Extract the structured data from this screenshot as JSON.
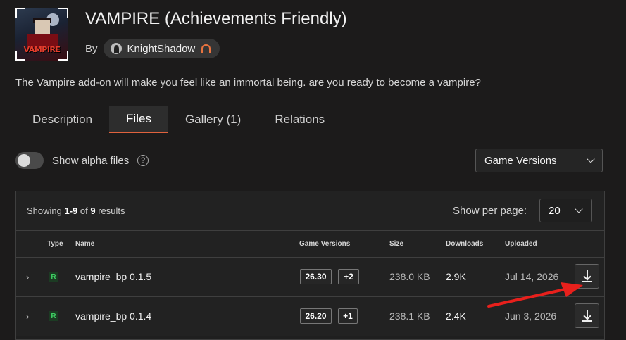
{
  "project": {
    "title": "VAMPIRE (Achievements Friendly)",
    "by_label": "By",
    "author": "KnightShadow",
    "thumbnail_text": "VAMPIRE",
    "description": "The Vampire add-on will make you feel like an immortal being. are you ready to become a vampire?"
  },
  "tabs": [
    {
      "label": "Description",
      "active": false
    },
    {
      "label": "Files",
      "active": true
    },
    {
      "label": "Gallery (1)",
      "active": false
    },
    {
      "label": "Relations",
      "active": false
    }
  ],
  "filters": {
    "alpha_toggle_label": "Show alpha files",
    "alpha_toggle_on": false,
    "help_glyph": "?",
    "game_versions_label": "Game Versions"
  },
  "results": {
    "showing_prefix": "Showing ",
    "range": "1-9",
    "of": " of ",
    "total": "9",
    "suffix": " results",
    "per_page_label": "Show per page:",
    "per_page_value": "20"
  },
  "table": {
    "headers": {
      "type": "Type",
      "name": "Name",
      "game_versions": "Game Versions",
      "size": "Size",
      "downloads": "Downloads",
      "uploaded": "Uploaded"
    },
    "rows": [
      {
        "expand": "›",
        "type": "R",
        "name": "vampire_bp 0.1.5",
        "version": "26.30",
        "extra": "+2",
        "size": "238.0 KB",
        "downloads": "2.9K",
        "uploaded": "Jul 14, 2026"
      },
      {
        "expand": "›",
        "type": "R",
        "name": "vampire_bp 0.1.4",
        "version": "26.20",
        "extra": "+1",
        "size": "238.1 KB",
        "downloads": "2.4K",
        "uploaded": "Jun 3, 2026"
      }
    ]
  },
  "colors": {
    "background": "#1c1b1b",
    "accent_tab_underline": "#e0623d",
    "release_badge": "#3ecf63",
    "annotation_arrow": "#e8201c"
  }
}
